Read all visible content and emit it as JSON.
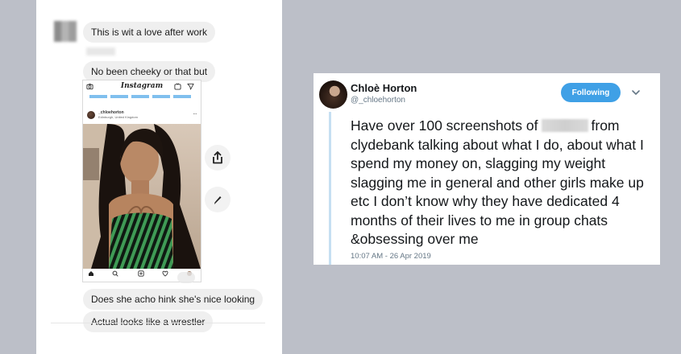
{
  "chat": {
    "messages": [
      "This is wit a love after work",
      "No been cheeky or that but",
      "Does she acho hink she's nice looking",
      "Actual looks like a wrestler"
    ],
    "instagram_post": {
      "app_name": "Instagram",
      "username": "_chloehorton",
      "location": "Edinburgh, United Kingdom",
      "icons": [
        "camera-icon",
        "igtv-icon",
        "direct-send-icon",
        "more-icon",
        "home-icon",
        "search-icon",
        "add-icon",
        "heart-icon",
        "profile-icon"
      ]
    },
    "side_buttons": [
      "share-icon",
      "edit-pencil-icon"
    ]
  },
  "tweet": {
    "name": "Chloè Horton",
    "handle": "@_chloehorton",
    "follow_label": "Following",
    "text_before": "Have over 100 screenshots of",
    "text_after": "from clydebank talking about what I do, about what I spend my money on, slagging my weight slagging me in general and other girls make up etc I don’t know why they have dedicated 4 months of their lives to me in group chats &obsessing over me",
    "timestamp": "10:07 AM - 26 Apr 2019",
    "colors": {
      "follow": "#3fa0e6",
      "thread": "#c6dff2"
    }
  }
}
